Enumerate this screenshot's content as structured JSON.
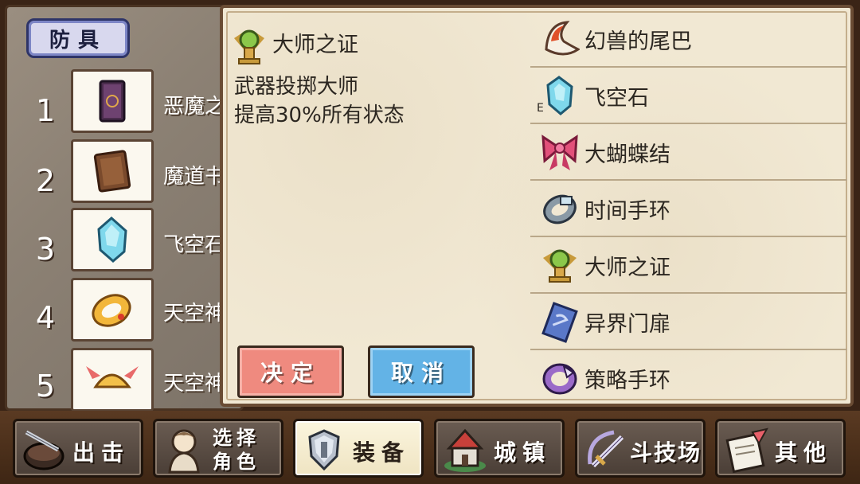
{
  "left_panel": {
    "section_tab": "防具",
    "rows": [
      {
        "num": "1",
        "name": "恶魔之",
        "icon": "demon-book-icon"
      },
      {
        "num": "2",
        "name": "魔道书",
        "icon": "magic-tome-icon"
      },
      {
        "num": "3",
        "name": "飞空石",
        "icon": "sky-stone-icon"
      },
      {
        "num": "4",
        "name": "天空神",
        "icon": "sky-ring-icon"
      },
      {
        "num": "5",
        "name": "天空神",
        "icon": "winged-helmet-icon"
      }
    ]
  },
  "popup": {
    "detail": {
      "title": "大师之证",
      "line1": "武器投掷大师",
      "line2": "提高30%所有状态",
      "icon": "master-badge-icon"
    },
    "confirm_label": "决定",
    "cancel_label": "取消",
    "marker": "E",
    "equipment": [
      {
        "label": "幻兽的尾巴",
        "icon": "beast-tail-icon"
      },
      {
        "label": "飞空石",
        "icon": "sky-stone-icon"
      },
      {
        "label": "大蝴蝶结",
        "icon": "big-ribbon-icon"
      },
      {
        "label": "时间手环",
        "icon": "time-bracelet-icon"
      },
      {
        "label": "大师之证",
        "icon": "master-badge-icon"
      },
      {
        "label": "异界门扉",
        "icon": "otherworld-gate-icon"
      },
      {
        "label": "策略手环",
        "icon": "strategy-bracelet-icon"
      }
    ]
  },
  "nav": [
    {
      "label": "出击",
      "icon": "sortie-icon"
    },
    {
      "label": "选择角色",
      "icon": "character-select-icon"
    },
    {
      "label": "装备",
      "icon": "armor-icon",
      "active": true
    },
    {
      "label": "城镇",
      "icon": "town-icon"
    },
    {
      "label": "斗技场",
      "icon": "arena-icon"
    },
    {
      "label": "其他",
      "icon": "other-icon"
    }
  ],
  "colors": {
    "confirm": "#ef8a7f",
    "cancel": "#63b3e6",
    "panel": "#f1e8d3",
    "frame": "#6a4c34"
  }
}
